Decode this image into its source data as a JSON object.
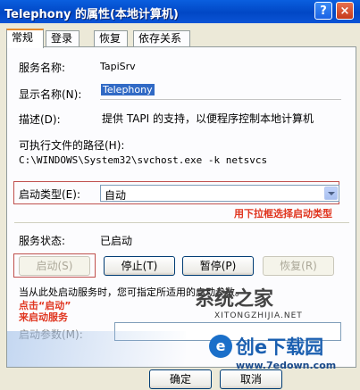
{
  "window": {
    "title": "Telephony 的属性(本地计算机)",
    "help_glyph": "?",
    "close_glyph": "×"
  },
  "tabs": [
    {
      "label": "常规",
      "active": true
    },
    {
      "label": "登录",
      "active": false
    },
    {
      "label": "恢复",
      "active": false
    },
    {
      "label": "依存关系",
      "active": false
    }
  ],
  "general": {
    "service_name_label": "服务名称:",
    "service_name_value": "TapiSrv",
    "display_name_label": "显示名称(N):",
    "display_name_value": "Telephony",
    "description_label": "描述(D):",
    "description_value": "提供 TAPI 的支持，以便程序控制本地计算机",
    "exe_path_label": "可执行文件的路径(H):",
    "exe_path_value": "C:\\WINDOWS\\System32\\svchost.exe -k netsvcs",
    "startup_type_label": "启动类型(E):",
    "startup_type_value": "自动",
    "service_status_label": "服务状态:",
    "service_status_value": "已启动",
    "buttons": {
      "start": "启动(S)",
      "stop": "停止(T)",
      "pause": "暂停(P)",
      "resume": "恢复(R)"
    },
    "start_params_hint": "当从此处启动服务时，您可指定所适用的启动参数。",
    "start_params_label": "启动参数(M):"
  },
  "annotations": {
    "dropdown_tip": "用下拉框选择启动类型",
    "start_tip_line1": "点击“启动”",
    "start_tip_line2": "来启动服务"
  },
  "footer": {
    "ok": "确定",
    "cancel": "取消"
  },
  "watermarks": {
    "site_name": "系统之家",
    "site_url": "XITONGZHIJIA.NET",
    "logo_text": "创e下载园",
    "logo_url": "www.7edown.com"
  },
  "colors": {
    "titlebar": "#0147c5",
    "annotation": "#e0351f",
    "selection": "#316ac5"
  }
}
